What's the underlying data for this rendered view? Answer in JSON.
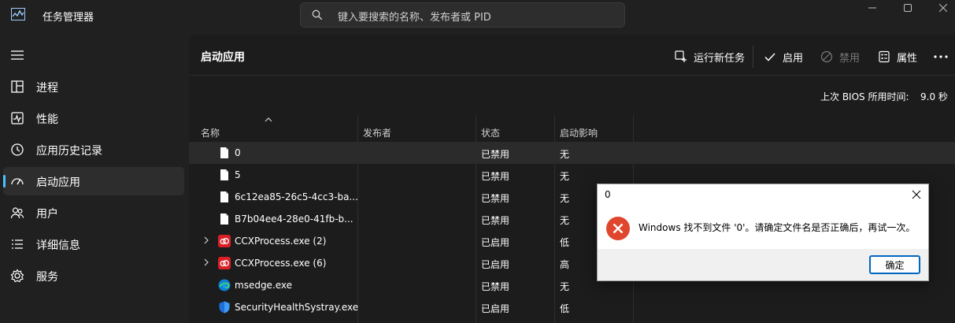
{
  "app": {
    "title": "任务管理器"
  },
  "search": {
    "placeholder": "键入要搜索的名称、发布者或 PID"
  },
  "sidebar": {
    "items": [
      {
        "label": "进程",
        "icon": "processes-icon"
      },
      {
        "label": "性能",
        "icon": "performance-icon"
      },
      {
        "label": "应用历史记录",
        "icon": "app-history-icon"
      },
      {
        "label": "启动应用",
        "icon": "startup-apps-icon",
        "active": true
      },
      {
        "label": "用户",
        "icon": "users-icon"
      },
      {
        "label": "详细信息",
        "icon": "details-icon"
      },
      {
        "label": "服务",
        "icon": "services-icon"
      }
    ]
  },
  "main": {
    "title": "启动应用",
    "toolbar": {
      "run_new_task": "运行新任务",
      "enable": "启用",
      "disable": "禁用",
      "properties": "属性"
    },
    "bios": {
      "label": "上次 BIOS 所用时间:",
      "value": "9.0 秒"
    },
    "table": {
      "columns": [
        "名称",
        "发布者",
        "状态",
        "启动影响"
      ],
      "rows": [
        {
          "name": "0",
          "publisher": "",
          "status": "已禁用",
          "impact": "无",
          "icon": "file-icon",
          "expandable": false
        },
        {
          "name": "5",
          "publisher": "",
          "status": "已禁用",
          "impact": "无",
          "icon": "file-icon",
          "expandable": false
        },
        {
          "name": "6c12ea85-26c5-4cc3-ba...",
          "publisher": "",
          "status": "已禁用",
          "impact": "无",
          "icon": "file-icon",
          "expandable": false
        },
        {
          "name": "B7b04ee4-28e0-41fb-b...",
          "publisher": "",
          "status": "已禁用",
          "impact": "无",
          "icon": "file-icon",
          "expandable": false
        },
        {
          "name": "CCXProcess.exe (2)",
          "publisher": "",
          "status": "已启用",
          "impact": "低",
          "icon": "creative-cloud-icon",
          "expandable": true
        },
        {
          "name": "CCXProcess.exe (6)",
          "publisher": "",
          "status": "已启用",
          "impact": "高",
          "icon": "creative-cloud-icon",
          "expandable": true
        },
        {
          "name": "msedge.exe",
          "publisher": "",
          "status": "已禁用",
          "impact": "无",
          "icon": "edge-icon",
          "expandable": false
        },
        {
          "name": "SecurityHealthSystray.exe",
          "publisher": "",
          "status": "已启用",
          "impact": "低",
          "icon": "shield-icon",
          "expandable": false
        }
      ]
    }
  },
  "dialog": {
    "title": "0",
    "message": "Windows 找不到文件 '0'。请确定文件名是否正确后，再试一次。",
    "ok_label": "确定"
  },
  "colors": {
    "accent": "#4cc2ff",
    "error": "#e0452e",
    "dialog_button_border": "#0067c0"
  }
}
